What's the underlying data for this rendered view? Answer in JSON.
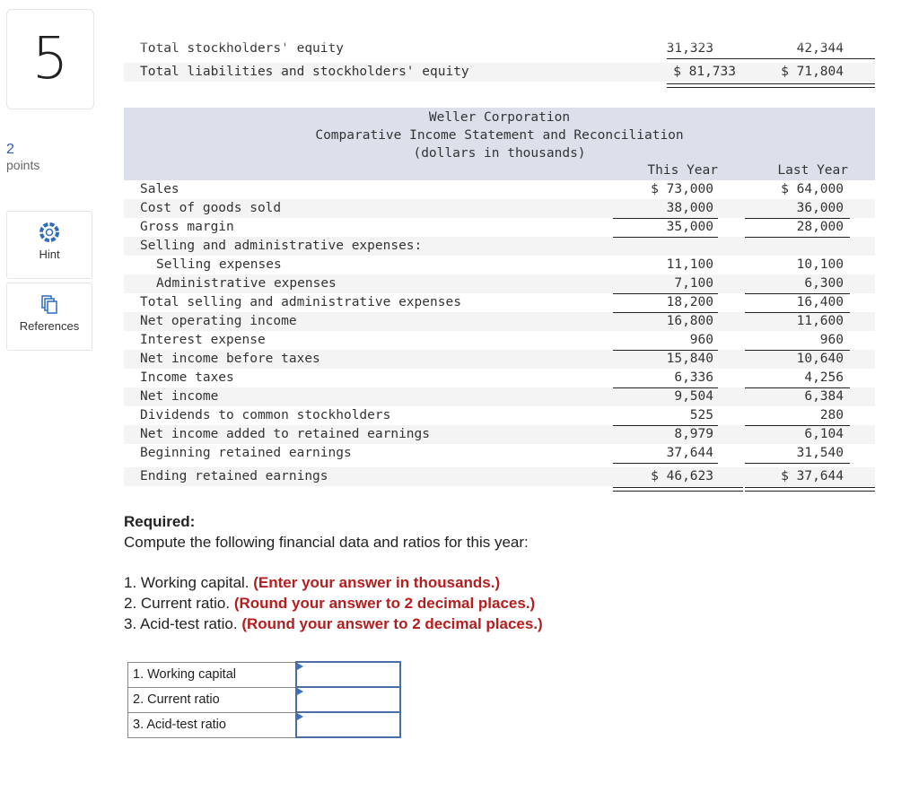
{
  "question_number": "5",
  "points": {
    "value": "2",
    "label": "points"
  },
  "side_buttons": [
    {
      "label": "Hint",
      "icon": "lifebuoy-icon"
    },
    {
      "label": "References",
      "icon": "documents-icon"
    }
  ],
  "balance_tail": {
    "rows": [
      {
        "label": "Total stockholders' equity",
        "this_year": "31,323",
        "last_year": "42,344"
      },
      {
        "label": "Total liabilities and stockholders' equity",
        "this_year": "$ 81,733",
        "last_year": "$ 71,804"
      }
    ]
  },
  "income_statement": {
    "title": "Weller Corporation",
    "subtitle": "Comparative Income Statement and Reconciliation",
    "units": "(dollars in thousands)",
    "col_this_year": "This Year",
    "col_last_year": "Last Year",
    "rows": [
      {
        "label": "Sales",
        "this_year": "$ 73,000",
        "last_year": "$ 64,000"
      },
      {
        "label": "Cost of goods sold",
        "this_year": "38,000",
        "last_year": "36,000"
      },
      {
        "label": "Gross margin",
        "this_year": "35,000",
        "last_year": "28,000"
      },
      {
        "label": "Selling and administrative expenses:",
        "this_year": "",
        "last_year": ""
      },
      {
        "label": "Selling expenses",
        "this_year": "11,100",
        "last_year": "10,100"
      },
      {
        "label": "Administrative expenses",
        "this_year": "7,100",
        "last_year": "6,300"
      },
      {
        "label": "Total selling and administrative expenses",
        "this_year": "18,200",
        "last_year": "16,400"
      },
      {
        "label": "Net operating income",
        "this_year": "16,800",
        "last_year": "11,600"
      },
      {
        "label": "Interest expense",
        "this_year": "960",
        "last_year": "960"
      },
      {
        "label": "Net income before taxes",
        "this_year": "15,840",
        "last_year": "10,640"
      },
      {
        "label": "Income taxes",
        "this_year": "6,336",
        "last_year": "4,256"
      },
      {
        "label": "Net income",
        "this_year": "9,504",
        "last_year": "6,384"
      },
      {
        "label": "Dividends to common stockholders",
        "this_year": "525",
        "last_year": "280"
      },
      {
        "label": "Net income added to retained earnings",
        "this_year": "8,979",
        "last_year": "6,104"
      },
      {
        "label": "Beginning retained earnings",
        "this_year": "37,644",
        "last_year": "31,540"
      },
      {
        "label": "Ending retained earnings",
        "this_year": "$ 46,623",
        "last_year": "$ 37,644"
      }
    ]
  },
  "required": {
    "heading": "Required:",
    "intro": "Compute the following financial data and ratios for this year:",
    "items": [
      {
        "text": "1. Working capital.",
        "note": "(Enter your answer in thousands.)"
      },
      {
        "text": "2. Current ratio.",
        "note": "(Round your answer to 2 decimal places.)"
      },
      {
        "text": "3. Acid-test ratio.",
        "note": "(Round your answer to 2 decimal places.)"
      }
    ]
  },
  "answers": [
    {
      "label": "1. Working capital",
      "value": ""
    },
    {
      "label": "2. Current ratio",
      "value": ""
    },
    {
      "label": "3. Acid-test ratio",
      "value": ""
    }
  ]
}
